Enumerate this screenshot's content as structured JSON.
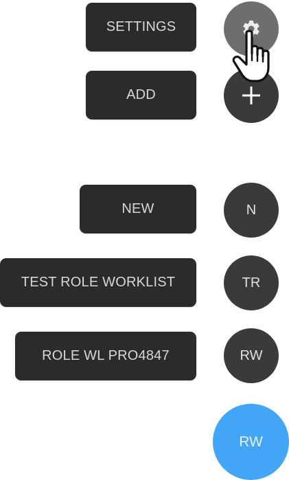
{
  "menu": {
    "settings": {
      "label": "SETTINGS",
      "icon": "gear-icon"
    },
    "add": {
      "label": "ADD",
      "icon": "plus-icon"
    },
    "items": [
      {
        "label": "NEW",
        "initials": "N"
      },
      {
        "label": "TEST ROLE WORKLIST",
        "initials": "TR"
      },
      {
        "label": "ROLE WL PRO4847",
        "initials": "RW"
      }
    ]
  },
  "main_fab": {
    "initials": "RW"
  },
  "colors": {
    "label_bg": "#2b2b2b",
    "fab_dark": "#3a3a3a",
    "fab_settings": "#6e6e6e",
    "fab_main": "#42a5f5"
  }
}
